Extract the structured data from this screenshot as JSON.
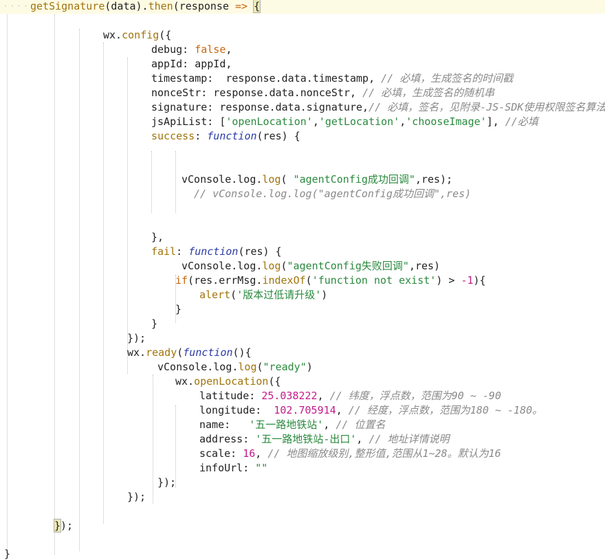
{
  "editor": {
    "ws_marker": "····",
    "lines": [
      {
        "indent": 44,
        "current": true,
        "tokens": [
          [
            "fn",
            "getSignature"
          ],
          [
            "op",
            "(data)."
          ],
          [
            "fn",
            "then"
          ],
          [
            "op",
            "(response "
          ],
          [
            "kw",
            "=>"
          ],
          [
            "op",
            " "
          ],
          [
            "hl",
            "{"
          ]
        ]
      },
      {
        "indent": 44,
        "tokens": []
      },
      {
        "indent": 150,
        "tokens": [
          [
            "op",
            "wx."
          ],
          [
            "fn",
            "config"
          ],
          [
            "op",
            "({"
          ]
        ]
      },
      {
        "indent": 220,
        "tokens": [
          [
            "prop",
            "debug"
          ],
          [
            "op",
            ": "
          ],
          [
            "kw",
            "false"
          ],
          [
            "op",
            ","
          ]
        ]
      },
      {
        "indent": 220,
        "tokens": [
          [
            "prop",
            "appId"
          ],
          [
            "op",
            ": appId,"
          ]
        ]
      },
      {
        "indent": 220,
        "tokens": [
          [
            "prop",
            "timestamp"
          ],
          [
            "op",
            ":  response.data.timestamp, "
          ],
          [
            "cmt",
            "// 必填，生成签名的时间戳"
          ]
        ]
      },
      {
        "indent": 220,
        "tokens": [
          [
            "prop",
            "nonceStr"
          ],
          [
            "op",
            ": response.data.nonceStr, "
          ],
          [
            "cmt",
            "// 必填，生成签名的随机串"
          ]
        ]
      },
      {
        "indent": 220,
        "tokens": [
          [
            "prop",
            "signature"
          ],
          [
            "op",
            ": response.data.signature,"
          ],
          [
            "cmt",
            "// 必填，签名，见附录-JS-SDK使用权限签名算法"
          ]
        ]
      },
      {
        "indent": 220,
        "tokens": [
          [
            "prop",
            "jsApiList"
          ],
          [
            "op",
            ": ["
          ],
          [
            "str",
            "'openLocation'"
          ],
          [
            "op",
            ","
          ],
          [
            "str",
            "'getLocation'"
          ],
          [
            "op",
            ","
          ],
          [
            "str",
            "'chooseImage'"
          ],
          [
            "op",
            "], "
          ],
          [
            "cmt",
            "//必填"
          ]
        ]
      },
      {
        "indent": 220,
        "tokens": [
          [
            "fn",
            "success"
          ],
          [
            "op",
            ": "
          ],
          [
            "kwi",
            "function"
          ],
          [
            "op",
            "(res) {"
          ]
        ]
      },
      {
        "indent": 220,
        "tokens": []
      },
      {
        "indent": 220,
        "tokens": []
      },
      {
        "indent": 264,
        "tokens": [
          [
            "op",
            "vConsole.log."
          ],
          [
            "fn",
            "log"
          ],
          [
            "op",
            "( "
          ],
          [
            "str",
            "\"agentConfig成功回调\""
          ],
          [
            "op",
            ",res);"
          ]
        ]
      },
      {
        "indent": 282,
        "tokens": [
          [
            "cmt",
            "// vConsole.log.log(\"agentConfig成功回调\",res)"
          ]
        ]
      },
      {
        "indent": 220,
        "tokens": []
      },
      {
        "indent": 220,
        "tokens": []
      },
      {
        "indent": 220,
        "tokens": [
          [
            "op",
            "},"
          ]
        ]
      },
      {
        "indent": 220,
        "tokens": [
          [
            "fn",
            "fail"
          ],
          [
            "op",
            ": "
          ],
          [
            "kwi",
            "function"
          ],
          [
            "op",
            "(res) {"
          ]
        ]
      },
      {
        "indent": 264,
        "tokens": [
          [
            "op",
            "vConsole.log."
          ],
          [
            "fn",
            "log"
          ],
          [
            "op",
            "("
          ],
          [
            "str",
            "\"agentConfig失败回调\""
          ],
          [
            "op",
            ",res)"
          ]
        ]
      },
      {
        "indent": 255,
        "tokens": [
          [
            "kw",
            "if"
          ],
          [
            "op",
            "(res.errMsg."
          ],
          [
            "fn",
            "indexOf"
          ],
          [
            "op",
            "("
          ],
          [
            "str",
            "'function not exist'"
          ],
          [
            "op",
            ") > "
          ],
          [
            "num",
            "-1"
          ],
          [
            "op",
            "){"
          ]
        ]
      },
      {
        "indent": 290,
        "tokens": [
          [
            "fn",
            "alert"
          ],
          [
            "op",
            "("
          ],
          [
            "str",
            "'版本过低请升级'"
          ],
          [
            "op",
            ")"
          ]
        ]
      },
      {
        "indent": 255,
        "tokens": [
          [
            "op",
            "}"
          ]
        ]
      },
      {
        "indent": 220,
        "tokens": [
          [
            "op",
            "}"
          ]
        ]
      },
      {
        "indent": 185,
        "tokens": [
          [
            "op",
            "});"
          ]
        ]
      },
      {
        "indent": 185,
        "tokens": [
          [
            "op",
            "wx."
          ],
          [
            "fn",
            "ready"
          ],
          [
            "op",
            "("
          ],
          [
            "kwi",
            "function"
          ],
          [
            "op",
            "(){"
          ]
        ]
      },
      {
        "indent": 229,
        "tokens": [
          [
            "op",
            "vConsole.log."
          ],
          [
            "fn",
            "log"
          ],
          [
            "op",
            "("
          ],
          [
            "str",
            "\"ready\""
          ],
          [
            "op",
            ")"
          ]
        ]
      },
      {
        "indent": 255,
        "tokens": [
          [
            "op",
            "wx."
          ],
          [
            "fn",
            "openLocation"
          ],
          [
            "op",
            "({"
          ]
        ]
      },
      {
        "indent": 290,
        "tokens": [
          [
            "prop",
            "latitude"
          ],
          [
            "op",
            ": "
          ],
          [
            "num",
            "25.038222"
          ],
          [
            "op",
            ", "
          ],
          [
            "cmt",
            "// 纬度，浮点数，范围为90 ~ -90"
          ]
        ]
      },
      {
        "indent": 290,
        "tokens": [
          [
            "prop",
            "longitude"
          ],
          [
            "op",
            ":  "
          ],
          [
            "num",
            "102.705914"
          ],
          [
            "op",
            ", "
          ],
          [
            "cmt",
            "// 经度，浮点数，范围为180 ~ -180。"
          ]
        ]
      },
      {
        "indent": 290,
        "tokens": [
          [
            "prop",
            "name"
          ],
          [
            "op",
            ":   "
          ],
          [
            "str",
            "'五一路地铁站'"
          ],
          [
            "op",
            ", "
          ],
          [
            "cmt",
            "// 位置名"
          ]
        ]
      },
      {
        "indent": 290,
        "tokens": [
          [
            "prop",
            "address"
          ],
          [
            "op",
            ": "
          ],
          [
            "str",
            "'五一路地铁站-出口'"
          ],
          [
            "op",
            ", "
          ],
          [
            "cmt",
            "// 地址详情说明"
          ]
        ]
      },
      {
        "indent": 290,
        "tokens": [
          [
            "prop",
            "scale"
          ],
          [
            "op",
            ": "
          ],
          [
            "num",
            "16"
          ],
          [
            "op",
            ", "
          ],
          [
            "cmt",
            "// 地图缩放级别,整形值,范围从1~28。默认为16"
          ]
        ]
      },
      {
        "indent": 290,
        "tokens": [
          [
            "prop",
            "infoUrl"
          ],
          [
            "op",
            ": "
          ],
          [
            "str",
            "\"\""
          ]
        ]
      },
      {
        "indent": 229,
        "tokens": [
          [
            "op",
            "});"
          ]
        ]
      },
      {
        "indent": 185,
        "tokens": [
          [
            "op",
            "});"
          ]
        ]
      },
      {
        "indent": 185,
        "tokens": []
      },
      {
        "indent": 79,
        "tokens": [
          [
            "hl",
            "}"
          ],
          [
            "op",
            ");"
          ]
        ]
      }
    ],
    "trailing_bracket": "}"
  }
}
